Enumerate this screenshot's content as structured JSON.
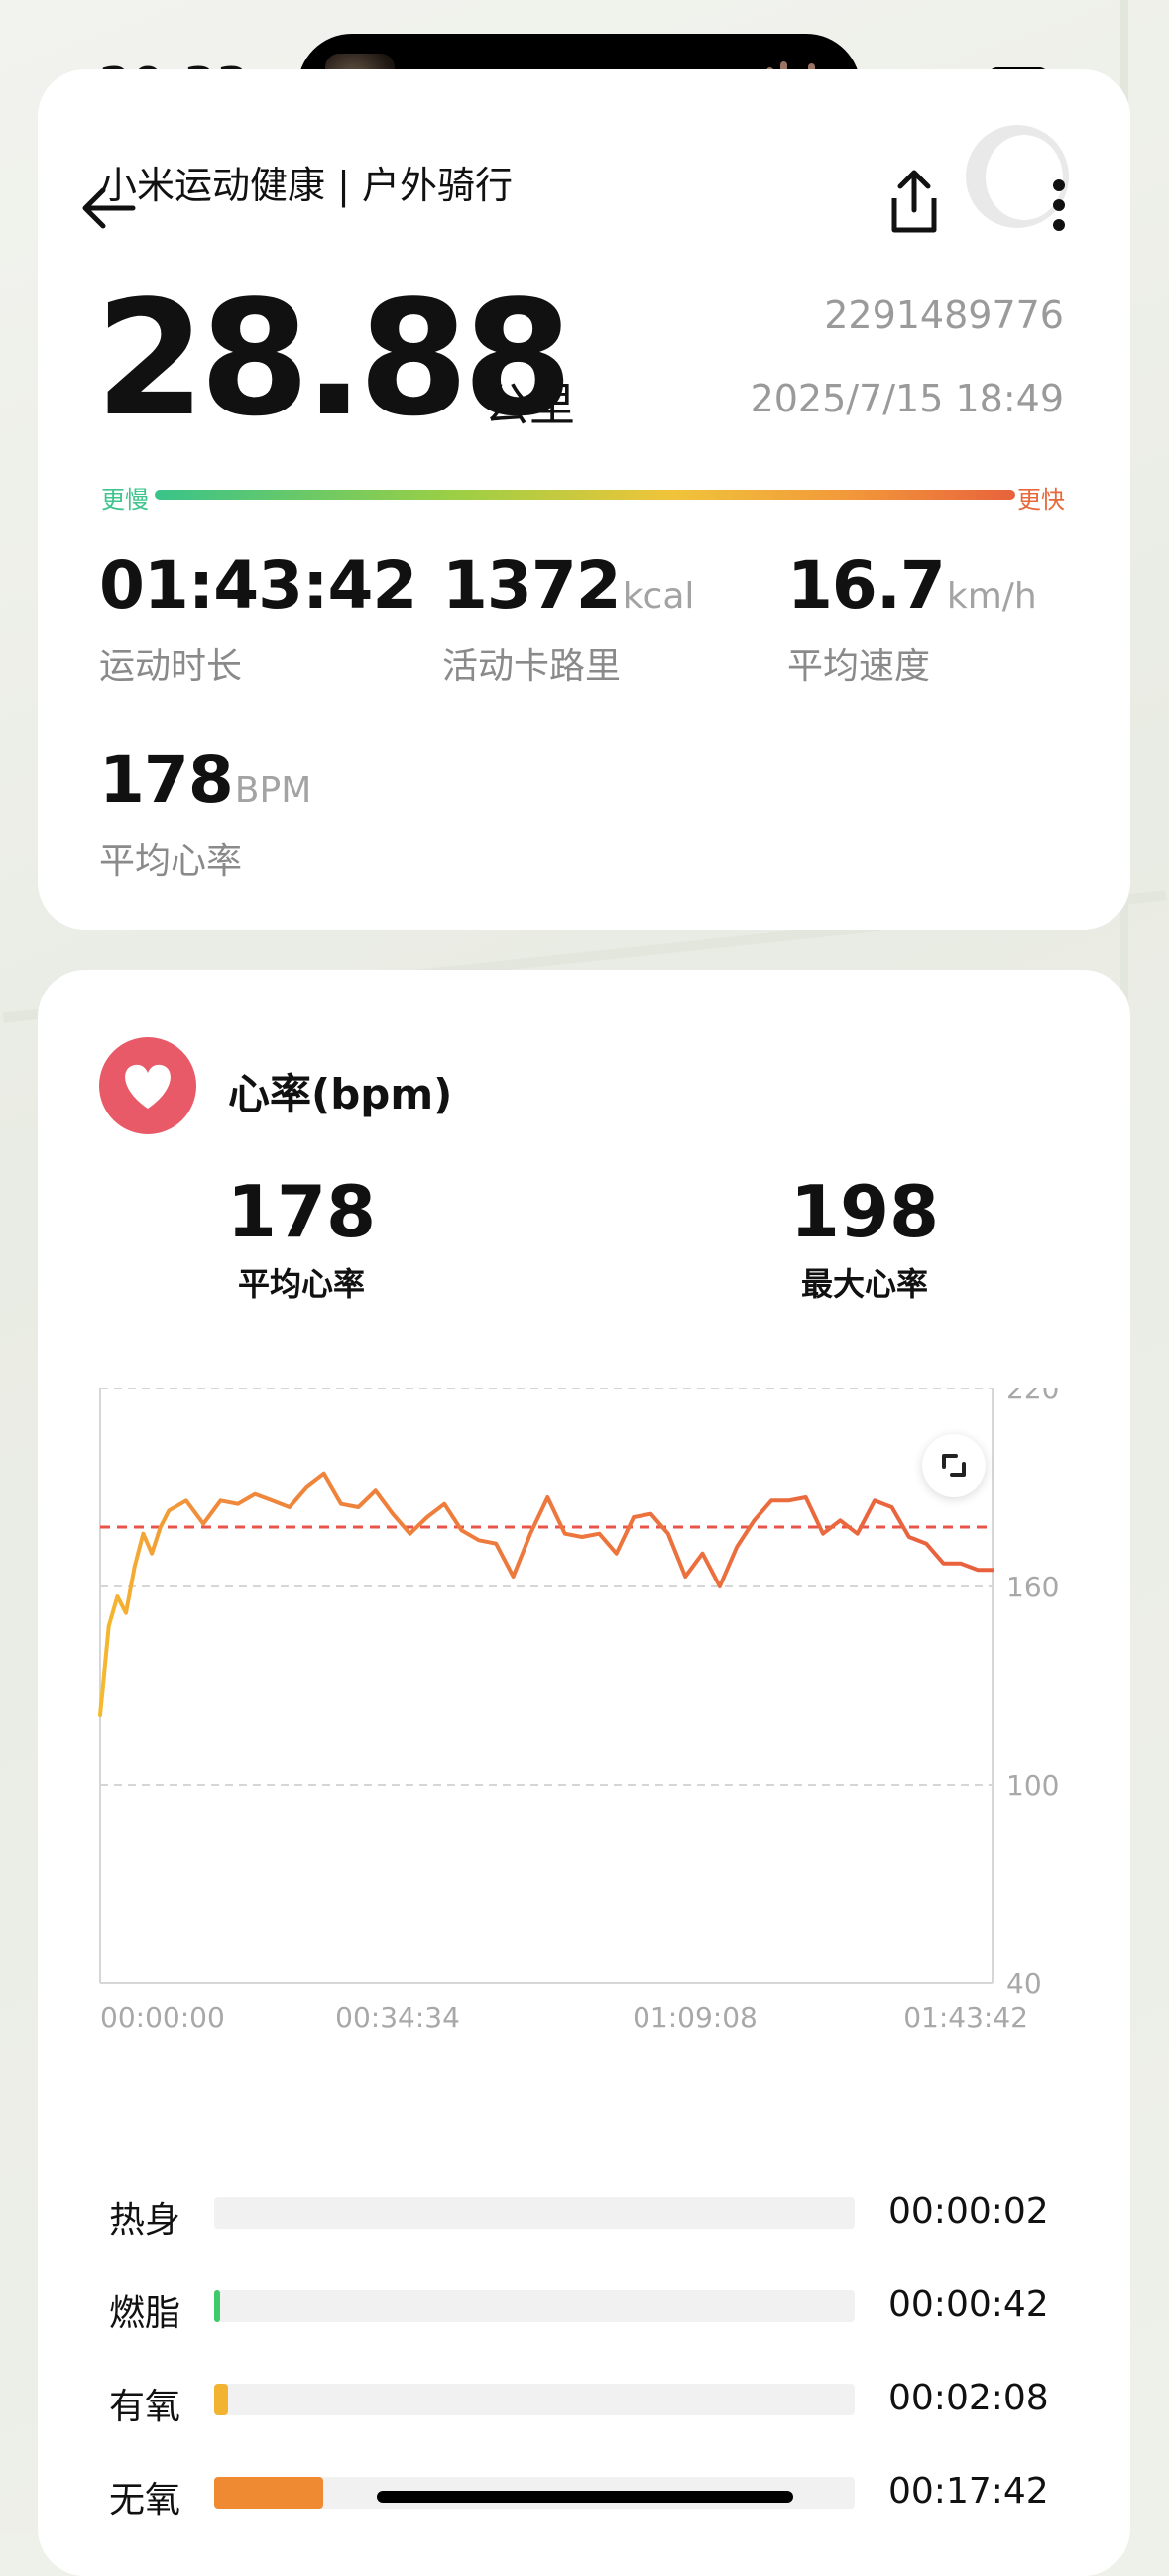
{
  "status_bar": {
    "time": "20:33"
  },
  "header": {
    "title": "小米运动健康 | 户外骑行"
  },
  "summary": {
    "distance": "28.88",
    "distance_unit": "公里",
    "record_id": "2291489776",
    "date": "2025/7/15 18:49",
    "speed_slow_label": "更慢",
    "speed_fast_label": "更快",
    "metrics": [
      {
        "value": "01:43:42",
        "unit": "",
        "label": "运动时长"
      },
      {
        "value": "1372",
        "unit": "kcal",
        "label": "活动卡路里"
      },
      {
        "value": "16.7",
        "unit": "km/h",
        "label": "平均速度"
      },
      {
        "value": "178",
        "unit": "BPM",
        "label": "平均心率"
      }
    ]
  },
  "heart_rate": {
    "title": "心率(bpm)",
    "avg_value": "178",
    "avg_label": "平均心率",
    "max_value": "198",
    "max_label": "最大心率"
  },
  "chart_data": {
    "type": "line",
    "title": "",
    "xlabel": "",
    "ylabel": "",
    "ylim": [
      40,
      220
    ],
    "y_ticks": [
      "220",
      "160",
      "100",
      "40"
    ],
    "x_ticks": [
      "00:00:00",
      "00:34:34",
      "01:09:08",
      "01:43:42"
    ],
    "reference_line": 178,
    "x_minutes": [
      0,
      1,
      2,
      3,
      4,
      5,
      6,
      7,
      8,
      10,
      12,
      14,
      16,
      18,
      20,
      22,
      24,
      26,
      28,
      30,
      32,
      34,
      36,
      38,
      40,
      42,
      44,
      46,
      48,
      50,
      52,
      54,
      56,
      58,
      60,
      62,
      64,
      66,
      68,
      70,
      72,
      74,
      76,
      78,
      80,
      82,
      84,
      86,
      88,
      90,
      92,
      94,
      96,
      98,
      100,
      102,
      103.7
    ],
    "values": [
      121,
      148,
      157,
      152,
      166,
      176,
      170,
      178,
      183,
      186,
      179,
      186,
      185,
      188,
      186,
      184,
      190,
      194,
      185,
      184,
      189,
      182,
      176,
      181,
      185,
      177,
      174,
      173,
      163,
      176,
      187,
      176,
      175,
      176,
      170,
      181,
      182,
      176,
      163,
      170,
      160,
      172,
      180,
      186,
      186,
      187,
      176,
      180,
      176,
      186,
      184,
      175,
      173,
      167,
      167,
      165,
      165
    ],
    "colors": {
      "start": "#f5b92e",
      "mid": "#f08a3c",
      "end": "#e8603e",
      "reference": "#e8544a",
      "grid": "#d6d6d6"
    }
  },
  "zones": [
    {
      "name": "热身",
      "time": "00:00:02",
      "fraction": 0.0,
      "color": "#bdbdbd"
    },
    {
      "name": "燃脂",
      "time": "00:00:42",
      "fraction": 0.007,
      "color": "#3ec96a"
    },
    {
      "name": "有氧",
      "time": "00:02:08",
      "fraction": 0.021,
      "color": "#f2b430"
    },
    {
      "name": "无氧",
      "time": "00:17:42",
      "fraction": 0.171,
      "color": "#ef8a33"
    }
  ]
}
